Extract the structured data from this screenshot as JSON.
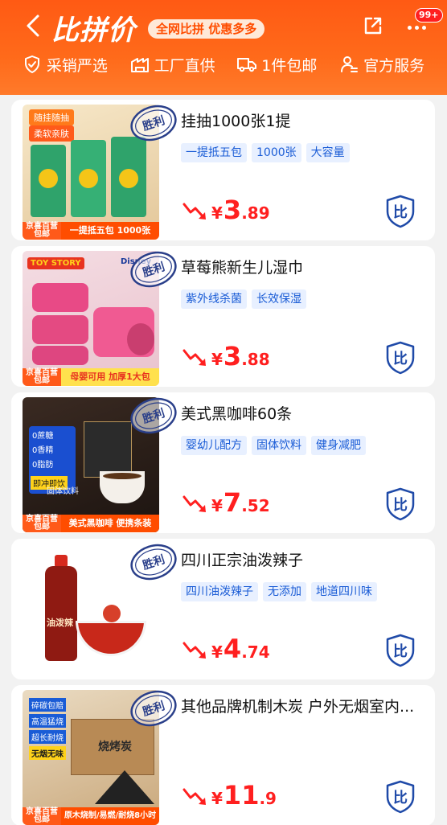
{
  "header": {
    "title": "比拼价",
    "slogan": "全网比拼 优惠多多",
    "badge": "99+"
  },
  "features": [
    {
      "icon": "shield-check-icon",
      "label": "采销严选"
    },
    {
      "icon": "factory-icon",
      "label": "工厂直供"
    },
    {
      "icon": "truck-icon",
      "label": "1件包邮"
    },
    {
      "icon": "service-icon",
      "label": "官方服务"
    }
  ],
  "products": [
    {
      "title": "挂抽1000张1提",
      "tags": [
        "一提抵五包",
        "1000张",
        "大容量"
      ],
      "price": {
        "yen": "¥",
        "int": "3",
        "dec": ".89"
      },
      "thumb": {
        "shop": "京喜百营 包邮",
        "caption": "一提抵五包 1000张",
        "label1": "随挂随抽",
        "label2": "柔软亲肤"
      },
      "stamp": "胜利"
    },
    {
      "title": "草莓熊新生儿湿巾",
      "tags": [
        "紫外线杀菌",
        "长效保湿"
      ],
      "price": {
        "yen": "¥",
        "int": "3",
        "dec": ".88"
      },
      "thumb": {
        "shop": "京喜百营 包邮",
        "caption": "母婴可用 加厚1大包",
        "label1": "TOY STORY",
        "label2": "Disney"
      },
      "stamp": "胜利"
    },
    {
      "title": "美式黑咖啡60条",
      "tags": [
        "婴幼儿配方",
        "固体饮料",
        "健身减肥"
      ],
      "price": {
        "yen": "¥",
        "int": "7",
        "dec": ".52"
      },
      "thumb": {
        "shop": "京喜百营 包邮",
        "caption": "美式黑咖啡 便携条装",
        "label1": "0蔗糖",
        "label2": "0香精",
        "label3": "0脂肪",
        "label4": "即冲即饮",
        "label5": "固体饮料"
      },
      "stamp": "胜利"
    },
    {
      "title": "四川正宗油泼辣子",
      "tags": [
        "四川油泼辣子",
        "无添加",
        "地道四川味"
      ],
      "price": {
        "yen": "¥",
        "int": "4",
        "dec": ".74"
      },
      "thumb": {
        "label1": "油泼辣"
      },
      "stamp": "胜利"
    },
    {
      "title": "其他品牌机制木炭 户外无烟室内...",
      "tags": [],
      "price": {
        "yen": "¥",
        "int": "11",
        "dec": ".9"
      },
      "thumb": {
        "shop": "京喜百营 包邮",
        "caption": "原木烧制/易燃/耐烧8小时",
        "label1": "碎碳包赔",
        "label2": "高温猛烧",
        "label3": "超长耐烧",
        "label4": "无烟无味",
        "label5": "烧烤炭"
      },
      "stamp": "胜利"
    }
  ],
  "colors": {
    "brand": "#ff5a14",
    "price": "#ff1f1f",
    "tag_bg": "#e8f0ff",
    "tag_text": "#1a5cd6",
    "compare": "#1f4aa8"
  },
  "compare_label": "比"
}
